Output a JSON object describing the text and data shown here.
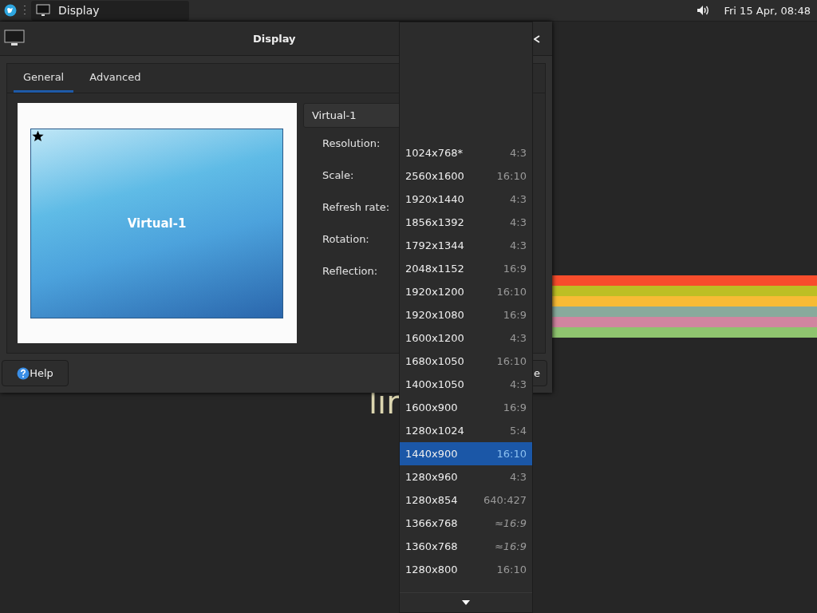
{
  "panel": {
    "task": {
      "title": "Display",
      "selected": true
    },
    "clock": "Fri 15 Apr, 08:48"
  },
  "desktop": {
    "wallpaper_text": "lir"
  },
  "window": {
    "title": "Display",
    "tabs": [
      {
        "label": "General",
        "selected": true
      },
      {
        "label": "Advanced",
        "selected": false
      }
    ],
    "preview": {
      "output_name": "Virtual-1",
      "primary": true
    },
    "output_combo": {
      "value": "Virtual-1"
    },
    "fields": [
      "Resolution:",
      "Scale:",
      "Refresh rate:",
      "Rotation:",
      "Reflection:"
    ],
    "help_button": "Help",
    "hidden_button": "e"
  },
  "resolution_menu": {
    "items": [
      {
        "resolution": "1024x768*",
        "ratio": "4:3",
        "approximate": false,
        "selected": false
      },
      {
        "resolution": "2560x1600",
        "ratio": "16:10",
        "approximate": false,
        "selected": false
      },
      {
        "resolution": "1920x1440",
        "ratio": "4:3",
        "approximate": false,
        "selected": false
      },
      {
        "resolution": "1856x1392",
        "ratio": "4:3",
        "approximate": false,
        "selected": false
      },
      {
        "resolution": "1792x1344",
        "ratio": "4:3",
        "approximate": false,
        "selected": false
      },
      {
        "resolution": "2048x1152",
        "ratio": "16:9",
        "approximate": false,
        "selected": false
      },
      {
        "resolution": "1920x1200",
        "ratio": "16:10",
        "approximate": false,
        "selected": false
      },
      {
        "resolution": "1920x1080",
        "ratio": "16:9",
        "approximate": false,
        "selected": false
      },
      {
        "resolution": "1600x1200",
        "ratio": "4:3",
        "approximate": false,
        "selected": false
      },
      {
        "resolution": "1680x1050",
        "ratio": "16:10",
        "approximate": false,
        "selected": false
      },
      {
        "resolution": "1400x1050",
        "ratio": "4:3",
        "approximate": false,
        "selected": false
      },
      {
        "resolution": "1600x900",
        "ratio": "16:9",
        "approximate": false,
        "selected": false
      },
      {
        "resolution": "1280x1024",
        "ratio": "5:4",
        "approximate": false,
        "selected": false
      },
      {
        "resolution": "1440x900",
        "ratio": "16:10",
        "approximate": false,
        "selected": true
      },
      {
        "resolution": "1280x960",
        "ratio": "4:3",
        "approximate": false,
        "selected": false
      },
      {
        "resolution": "1280x854",
        "ratio": "640:427",
        "approximate": false,
        "selected": false
      },
      {
        "resolution": "1366x768",
        "ratio": "≈16:9",
        "approximate": true,
        "selected": false
      },
      {
        "resolution": "1360x768",
        "ratio": "≈16:9",
        "approximate": true,
        "selected": false
      },
      {
        "resolution": "1280x800",
        "ratio": "16:10",
        "approximate": false,
        "selected": false
      }
    ]
  }
}
